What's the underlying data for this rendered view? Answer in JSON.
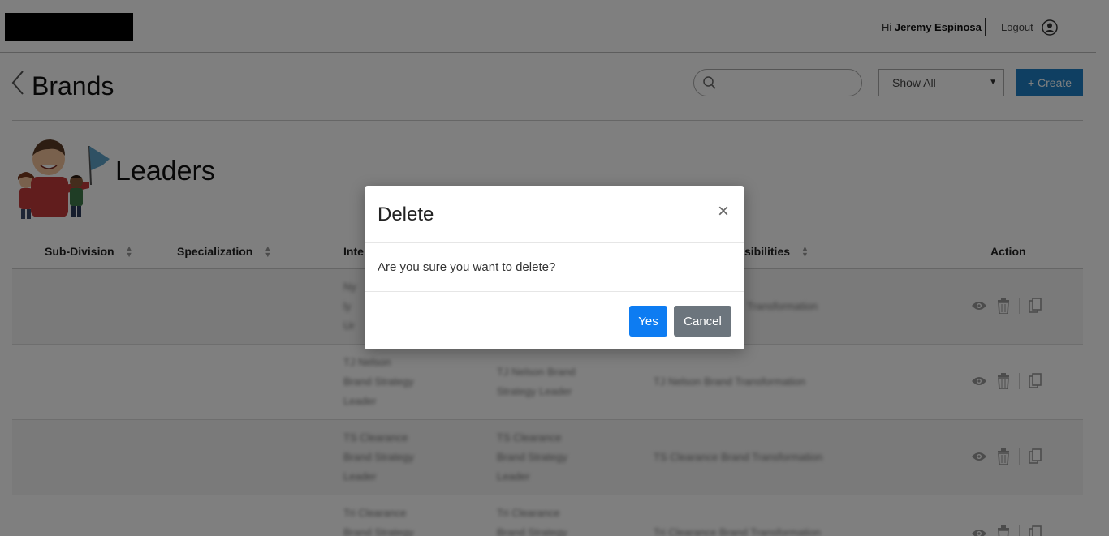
{
  "header": {
    "greeting_prefix": "Hi",
    "user_name": "Jeremy Espinosa",
    "logout_label": "Logout"
  },
  "page": {
    "title": "Brands",
    "search_placeholder": "",
    "filter_selected": "Show All",
    "create_label": "+ Create"
  },
  "section": {
    "title": "Leaders"
  },
  "table": {
    "columns": [
      "Sub-Division",
      "Specialization",
      "Inte",
      "sibilities",
      "Action"
    ],
    "rows": [
      {
        "col3": [
          "Ny",
          "ly",
          "Ur"
        ],
        "col4": [],
        "col5": "Transformation"
      },
      {
        "col3": [
          "TJ Nelson",
          "Brand Strategy",
          "Leader"
        ],
        "col4": [
          "TJ Nelson Brand",
          "Strategy Leader"
        ],
        "col5": "TJ Nelson Brand Transformation"
      },
      {
        "col3": [
          "TS Clearance",
          "Brand Strategy",
          "Leader"
        ],
        "col4": [
          "TS Clearance",
          "Brand Strategy",
          "Leader"
        ],
        "col5": "TS Clearance Brand Transformation"
      },
      {
        "col3": [
          "Tri Clearance",
          "Brand Strategy"
        ],
        "col4": [
          "Tri Clearance",
          "Brand Strategy"
        ],
        "col5": "Tri Clearance Brand Transformation"
      }
    ]
  },
  "modal": {
    "title": "Delete",
    "close_symbol": "×",
    "message": "Are you sure you want to delete?",
    "yes_label": "Yes",
    "cancel_label": "Cancel"
  },
  "colors": {
    "primary": "#1e7fc4",
    "yes_button": "#0d7cf2",
    "cancel_button": "#6c757d",
    "overlay": "rgba(0,0,0,0.5)"
  }
}
